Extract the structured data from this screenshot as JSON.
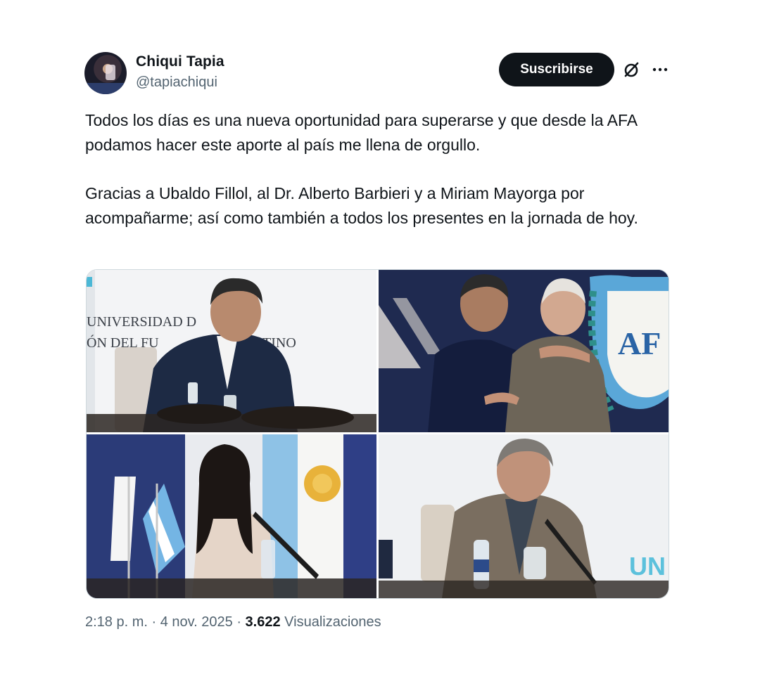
{
  "author": {
    "name": "Chiqui Tapia",
    "handle": "@tapiachiqui"
  },
  "actions": {
    "subscribe_label": "Suscribirse",
    "grok_icon": "grok-icon",
    "more_icon": "more-dots-icon"
  },
  "tweet": {
    "paragraphs": [
      "Todos los días es una nueva oportunidad para superarse y que desde la AFA podamos hacer este aporte al país me llena de orgullo.",
      "Gracias a Ubaldo Fillol, al Dr. Alberto Barbieri y a Miriam Mayorga por acompañarme; así como también a todos los presentes en la jornada de hoy."
    ]
  },
  "media": {
    "photo1": {
      "sign_line1": "UNIVERSIDAD D",
      "sign_line2": "ÓN DEL FU",
      "sign_line2b": "TINO"
    },
    "photo2": {
      "shield_text": "AF"
    },
    "photo4": {
      "sign_text": "UN"
    }
  },
  "meta": {
    "time": "2:18 p. m.",
    "separator1": " · ",
    "date": "4 nov. 2025",
    "separator2": " · ",
    "views_count": "3.622",
    "views_label": " Visualizaciones"
  },
  "colors": {
    "text": "#0f1419",
    "secondary": "#536471",
    "button_bg": "#0f1419",
    "button_text": "#ffffff",
    "border": "#cfd9de"
  }
}
